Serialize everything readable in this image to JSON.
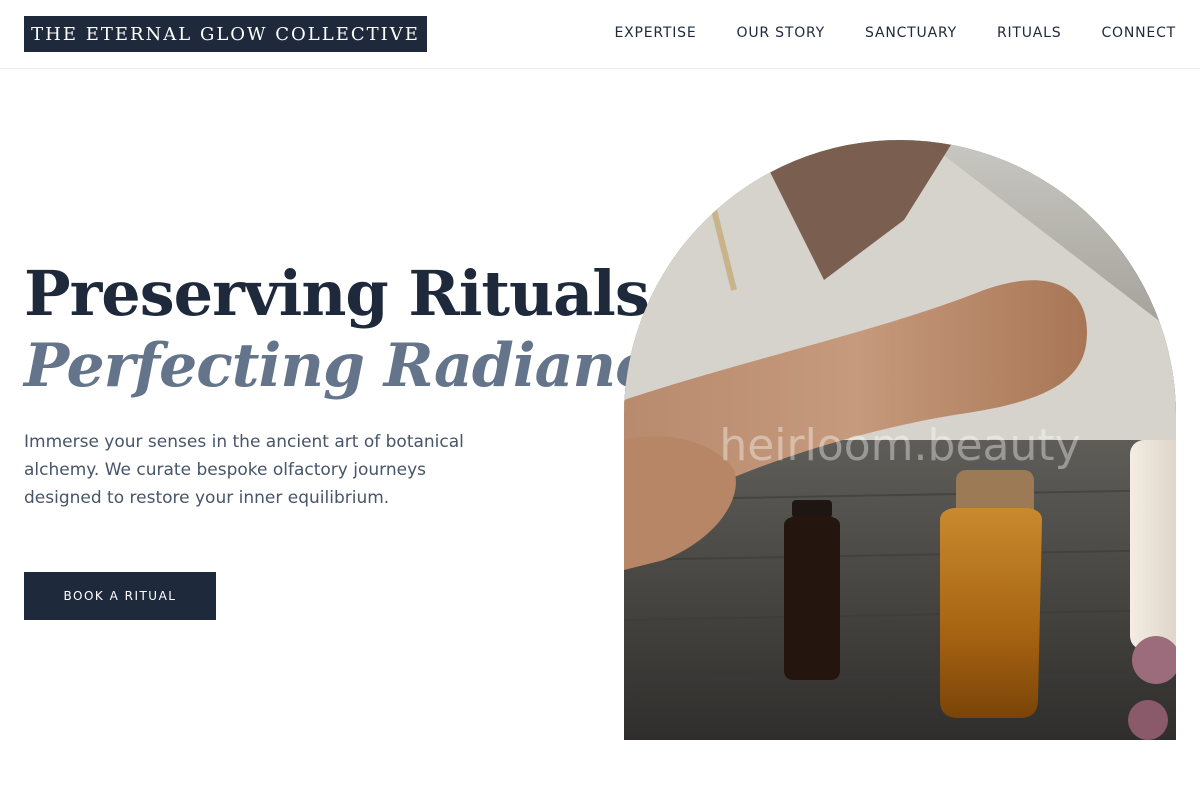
{
  "header": {
    "logo_text": "THE ETERNAL GLOW COLLECTIVE",
    "nav": [
      "EXPERTISE",
      "OUR STORY",
      "SANCTUARY",
      "RITUALS",
      "CONNECT"
    ]
  },
  "hero": {
    "title_line1": "Preserving Rituals,",
    "title_line2": "Perfecting Radiance.",
    "description": "Immerse your senses in the ancient art of botanical alchemy. We curate bespoke olfactory journeys designed to restore your inner equilibrium.",
    "cta_label": "BOOK A RITUAL",
    "image_watermark": "heirloom.beauty"
  },
  "colors": {
    "navy": "#1e293b",
    "slate": "#64748b",
    "text_muted": "#475569",
    "background": "#ffffff"
  }
}
